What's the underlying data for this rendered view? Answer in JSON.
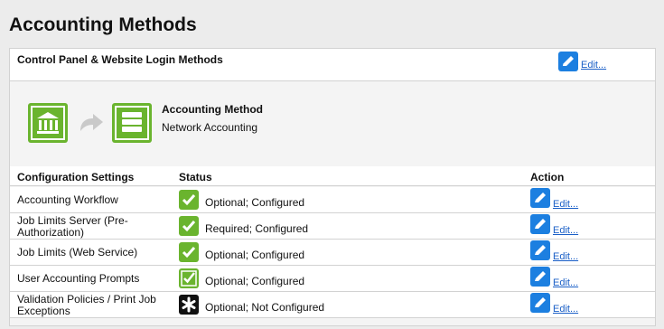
{
  "page": {
    "title": "Accounting Methods"
  },
  "login_panel": {
    "title": "Control Panel & Website Login Methods",
    "edit_label": "Edit..."
  },
  "method": {
    "label": "Accounting Method",
    "value": "Network Accounting"
  },
  "config": {
    "headers": {
      "setting": "Configuration Settings",
      "status": "Status",
      "action": "Action"
    },
    "rows": [
      {
        "setting": "Accounting Workflow",
        "status": "Optional; Configured",
        "status_icon": "check-icon",
        "edit": "Edit..."
      },
      {
        "setting": "Job Limits Server (Pre-Authorization)",
        "status": "Required; Configured",
        "status_icon": "check-icon",
        "edit": "Edit..."
      },
      {
        "setting": "Job Limits (Web Service)",
        "status": "Optional; Configured",
        "status_icon": "check-icon",
        "edit": "Edit..."
      },
      {
        "setting": "User Accounting Prompts",
        "status": "Optional; Configured",
        "status_icon": "check-outline-icon",
        "edit": "Edit..."
      },
      {
        "setting": "Validation Policies / Print Job Exceptions",
        "status": "Optional; Not Configured",
        "status_icon": "asterisk-icon",
        "edit": "Edit..."
      }
    ]
  },
  "colors": {
    "accent_blue": "#1c7fe0",
    "ok_green": "#6ab42e",
    "not_configured_black": "#111111"
  }
}
